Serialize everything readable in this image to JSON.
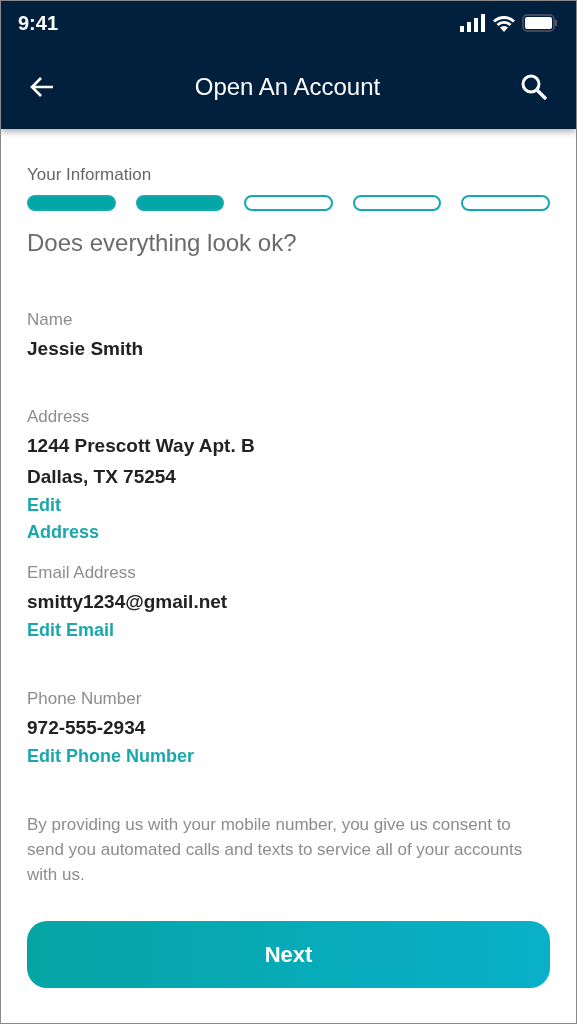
{
  "status_bar": {
    "time": "9:41"
  },
  "nav": {
    "title": "Open An Account"
  },
  "progress": {
    "label": "Your Information",
    "steps": [
      {
        "complete": true
      },
      {
        "complete": true
      },
      {
        "complete": false
      },
      {
        "complete": false
      },
      {
        "complete": false
      }
    ]
  },
  "heading": "Does everything look ok?",
  "fields": [
    {
      "label": "Name",
      "lines": [
        "Jessie Smith"
      ]
    },
    {
      "label": "Address",
      "lines": [
        "1244 Prescott Way Apt. B",
        "Dallas, TX 75254"
      ],
      "edit_link": "Edit Address"
    },
    {
      "label": "Email Address",
      "lines": [
        "smitty1234@gmail.net"
      ],
      "edit_link": "Edit Email"
    },
    {
      "label": "Phone Number",
      "lines": [
        "972-555-2934"
      ],
      "edit_link": "Edit Phone Number"
    }
  ],
  "disclaimer": "By providing us with your mobile number, you give us consent to send you automated calls and texts to service all of your accounts with us.",
  "buttons": [
    {
      "label": "Next"
    }
  ]
}
